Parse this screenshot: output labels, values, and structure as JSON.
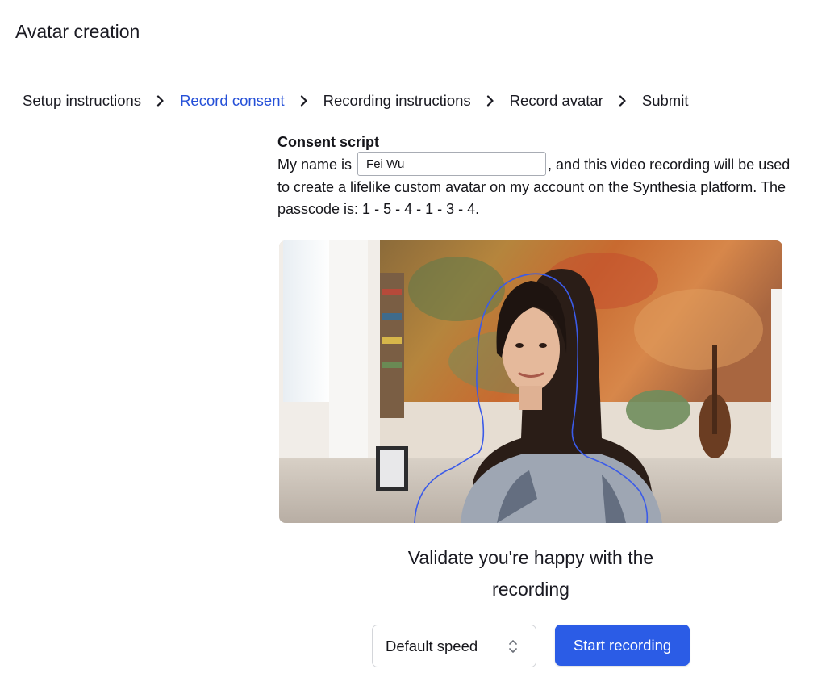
{
  "page": {
    "title": "Avatar creation"
  },
  "steps": [
    {
      "label": "Setup instructions",
      "active": false
    },
    {
      "label": "Record consent",
      "active": true
    },
    {
      "label": "Recording instructions",
      "active": false
    },
    {
      "label": "Record avatar",
      "active": false
    },
    {
      "label": "Submit",
      "active": false
    }
  ],
  "consent": {
    "heading": "Consent script",
    "prefix": "My name is",
    "name_value": "Fei Wu",
    "suffix": ", and this video recording will be used to create a lifelike custom avatar on my account on the Synthesia platform. The passcode is: 1 - 5 - 4 - 1 - 3 - 4."
  },
  "preview": {
    "icon": "camera-preview"
  },
  "validate_text": "Validate you're happy with the recording",
  "controls": {
    "speed_label": "Default speed",
    "start_label": "Start recording"
  },
  "colors": {
    "accent": "#2b5ce6",
    "active_step": "#2550d8",
    "outline": "#3b5be8"
  }
}
